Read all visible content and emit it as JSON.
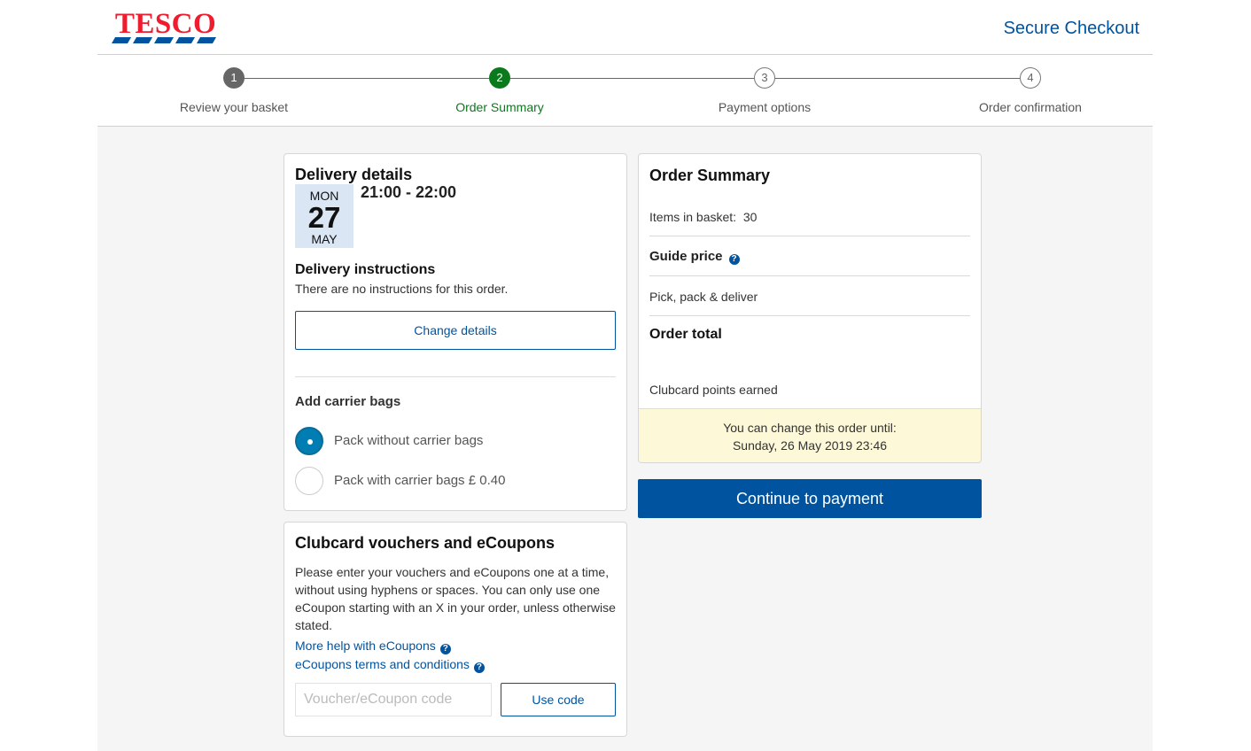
{
  "header": {
    "logo_text": "TESCO",
    "secure_checkout": "Secure Checkout"
  },
  "stepper": {
    "steps": [
      {
        "number": "1",
        "label": "Review your basket",
        "state": "done"
      },
      {
        "number": "2",
        "label": "Order Summary",
        "state": "active"
      },
      {
        "number": "3",
        "label": "Payment options",
        "state": "todo"
      },
      {
        "number": "4",
        "label": "Order confirmation",
        "state": "todo"
      }
    ]
  },
  "delivery": {
    "title": "Delivery details",
    "day_of_week": "MON",
    "day": "27",
    "month": "MAY",
    "time_range": "21:00 - 22:00",
    "instructions_title": "Delivery instructions",
    "instructions_text": "There are no instructions for this order.",
    "change_button": "Change details",
    "bags_title": "Add carrier bags",
    "bag_options": [
      {
        "label": "Pack without carrier bags",
        "selected": true
      },
      {
        "label": "Pack with carrier bags £ 0.40",
        "selected": false
      }
    ]
  },
  "clubcard": {
    "title": "Clubcard vouchers and eCoupons",
    "description": "Please enter your vouchers and eCoupons one at a time, without using hyphens or spaces. You can only use one eCoupon starting with an X in your order, unless otherwise stated.",
    "help_link": "More help with eCoupons",
    "terms_link": "eCoupons terms and conditions",
    "input_placeholder": "Voucher/eCoupon code",
    "input_value": "",
    "use_code_button": "Use code"
  },
  "summary": {
    "title": "Order Summary",
    "items_label": "Items in basket:",
    "items_count": "30",
    "guide_price": "Guide price",
    "pick_pack": "Pick, pack & deliver",
    "order_total": "Order total",
    "clubcard_points": "Clubcard points earned",
    "notice_line1": "You can change this order until:",
    "notice_line2": "Sunday, 26 May 2019 23:46"
  },
  "continue_button": "Continue to payment",
  "colors": {
    "brand_blue": "#00539f",
    "tesco_red": "#ee1c2e",
    "step_active_green": "#0a7a1c",
    "notice_yellow": "#fdf8d8",
    "radio_selected": "#007eb3"
  },
  "icons": {
    "help": "question-circle-icon",
    "logo_stripes": "tesco-stripes-icon"
  }
}
